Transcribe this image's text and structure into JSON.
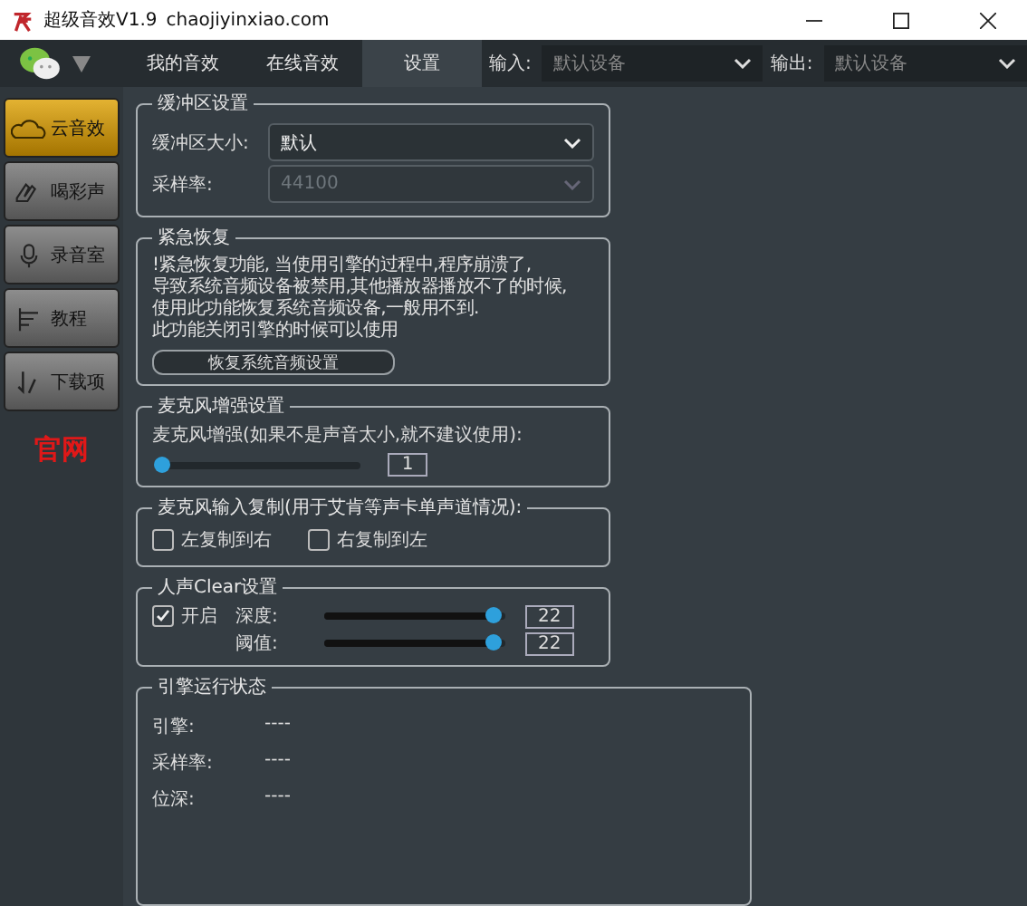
{
  "window": {
    "title": "超级音效V1.9",
    "url": "chaojiyinxiao.com"
  },
  "tabs": [
    {
      "label": "我的音效",
      "selected": false
    },
    {
      "label": "在线音效",
      "selected": false
    },
    {
      "label": "设置",
      "selected": true
    }
  ],
  "input": {
    "label": "输入:",
    "value": "默认设备"
  },
  "output": {
    "label": "输出:",
    "value": "默认设备"
  },
  "sidebar": {
    "items": [
      {
        "label": "云音效",
        "kind": "cloud",
        "selected": true
      },
      {
        "label": "喝彩声",
        "kind": "applause",
        "selected": false
      },
      {
        "label": "录音室",
        "kind": "mic",
        "selected": false
      },
      {
        "label": "教程",
        "kind": "tutorial",
        "selected": false
      },
      {
        "label": "下载项",
        "kind": "download",
        "selected": false
      }
    ],
    "link": "官网"
  },
  "buffer": {
    "title": "缓冲区设置",
    "fields": [
      {
        "label": "缓冲区大小:",
        "value": "默认",
        "disabled": false
      },
      {
        "label": "采样率:",
        "value": "44100",
        "disabled": true
      }
    ]
  },
  "emergency": {
    "title": "紧急恢复",
    "text": "!紧急恢复功能, 当使用引擎的过程中,程序崩溃了,\n导致系统音频设备被禁用,其他播放器播放不了的时候,\n使用此功能恢复系统音频设备,一般用不到.\n此功能关闭引擎的时候可以使用",
    "button": "恢复系统音频设置"
  },
  "mic_boost": {
    "title": "麦克风增强设置",
    "label": "麦克风增强(如果不是声音太小,就不建议使用):",
    "level": 0,
    "value": "1"
  },
  "mic_copy": {
    "title": "麦克风输入复制(用于艾肯等声卡单声道情况):",
    "options": [
      {
        "label": "左复制到右",
        "checked": false
      },
      {
        "label": "右复制到左",
        "checked": false
      }
    ]
  },
  "clear": {
    "title": "人声Clear设置",
    "enable": {
      "label": "开启",
      "checked": true
    },
    "sliders": [
      {
        "label": "深度:",
        "level": 0.93,
        "value": "22"
      },
      {
        "label": "阈值:",
        "level": 0.93,
        "value": "22"
      }
    ]
  },
  "status": {
    "title": "引擎运行状态",
    "rows": [
      {
        "label": "引擎:",
        "value": "----"
      },
      {
        "label": "采样率:",
        "value": "----"
      },
      {
        "label": "位深:",
        "value": "----"
      }
    ]
  }
}
